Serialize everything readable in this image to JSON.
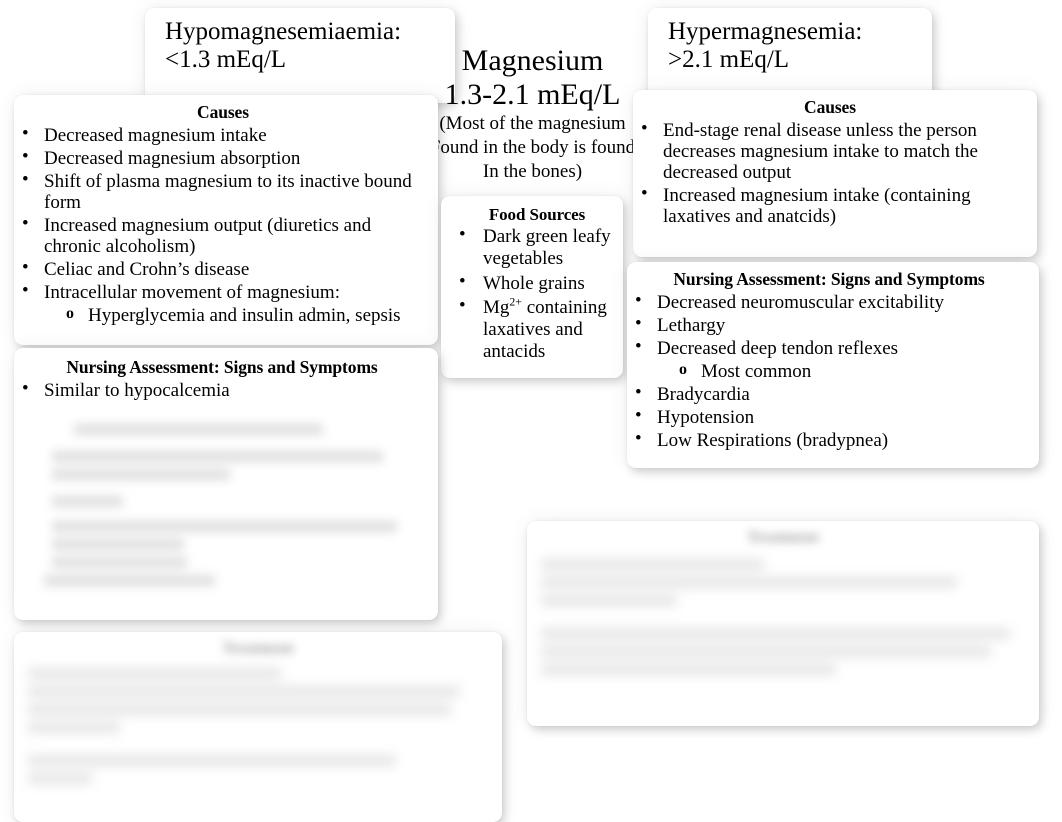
{
  "slide": {
    "background_color": "#ffffff",
    "text_color": "#000000"
  },
  "center_title": {
    "heading_line1": "Magnesium",
    "heading_line2": "1.3-2.1 mEq/L",
    "note_line1": "(Most of the magnesium",
    "note_line2": "Found in the body is found",
    "note_line3": "In the bones)"
  },
  "hypo_banner": {
    "line1": "Hypomagnesemiaemia:",
    "line2": "<1.3 mEq/L"
  },
  "hyper_banner": {
    "line1": "Hypermagnesemia:",
    "line2": ">2.1 mEq/L"
  },
  "hypo_causes": {
    "title": "Causes",
    "items": [
      {
        "text": "Decreased magnesium intake",
        "level": 1
      },
      {
        "text": "Decreased magnesium absorption",
        "level": 1
      },
      {
        "text": "Shift of plasma magnesium to its inactive bound form",
        "level": 1
      },
      {
        "text": "Increased magnesium output (diuretics and chronic alcoholism)",
        "level": 1
      },
      {
        "text": "Celiac and Crohn’s disease",
        "level": 1
      },
      {
        "text": "Intracellular movement of magnesium:",
        "level": 1
      },
      {
        "text": "Hyperglycemia and insulin admin, sepsis",
        "level": 2
      }
    ]
  },
  "hyper_causes": {
    "title": "Causes",
    "items": [
      {
        "text": "End-stage renal disease unless the person decreases magnesium intake to match the decreased output",
        "level": 1
      },
      {
        "text": "Increased magnesium intake (containing laxatives and anatcids)",
        "level": 1
      }
    ]
  },
  "food_sources": {
    "title": "Food Sources",
    "items": [
      {
        "text": "Dark green leafy vegetables",
        "level": 1
      },
      {
        "text": "Whole grains",
        "level": 1
      },
      {
        "text": "Mg2+ containing laxatives and antacids",
        "level": 1,
        "html": "Mg<sup>2+</sup> containing laxatives and antacids"
      }
    ]
  },
  "hypo_assessment": {
    "title": "Nursing Assessment: Signs and Symptoms",
    "items": [
      {
        "text": "Similar to hypocalcemia",
        "level": 1
      }
    ],
    "redacted_note": "remaining content is blurred / illegible"
  },
  "hyper_assessment": {
    "title": "Nursing Assessment: Signs and Symptoms",
    "items": [
      {
        "text": "Decreased neuromuscular excitability",
        "level": 1
      },
      {
        "text": "Lethargy",
        "level": 1
      },
      {
        "text": "Decreased deep tendon reflexes",
        "level": 1
      },
      {
        "text": "Most common",
        "level": 2
      },
      {
        "text": "Bradycardia",
        "level": 1
      },
      {
        "text": "Hypotension",
        "level": 1
      },
      {
        "text": "Low Respirations (bradypnea)",
        "level": 1
      }
    ]
  },
  "hypo_treatment": {
    "title": "Treatment",
    "redacted": true,
    "redacted_note": "content blurred / illegible"
  },
  "hyper_treatment": {
    "title": "Treatment",
    "redacted": true,
    "redacted_note": "content blurred / illegible"
  }
}
